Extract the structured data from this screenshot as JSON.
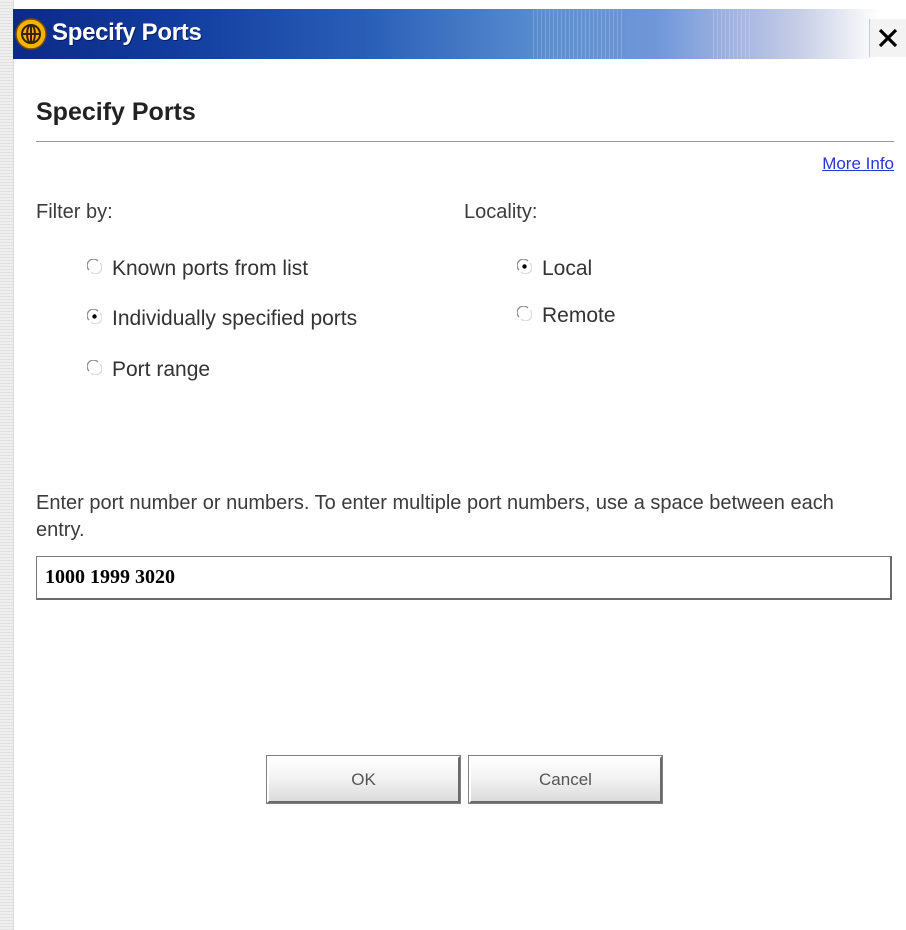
{
  "window": {
    "title": "Specify Ports",
    "close_glyph": "✕"
  },
  "dialog": {
    "heading": "Specify Ports",
    "more_info_link": "More Info"
  },
  "filter": {
    "label": "Filter by:",
    "options": [
      {
        "label": "Known ports from list",
        "selected": false
      },
      {
        "label": "Individually specified ports",
        "selected": true
      },
      {
        "label": "Port range",
        "selected": false
      }
    ]
  },
  "locality": {
    "label": "Locality:",
    "options": [
      {
        "label": "Local",
        "selected": true
      },
      {
        "label": "Remote",
        "selected": false
      }
    ]
  },
  "ports": {
    "description": "Enter port number or numbers. To enter multiple port numbers, use a space between each entry.",
    "value": "1000 1999 3020"
  },
  "buttons": {
    "ok_label": "OK",
    "cancel_label": "Cancel"
  },
  "colors": {
    "titlebar_start": "#0c2a88",
    "titlebar_end": "#ffffff",
    "link": "#2a35d6",
    "icon_yellow": "#f2b400"
  },
  "icons": {
    "app_icon": "globe-icon",
    "close_icon": "close-icon",
    "radio_selected": "radio-selected-icon",
    "radio_unselected": "radio-unselected-icon"
  }
}
